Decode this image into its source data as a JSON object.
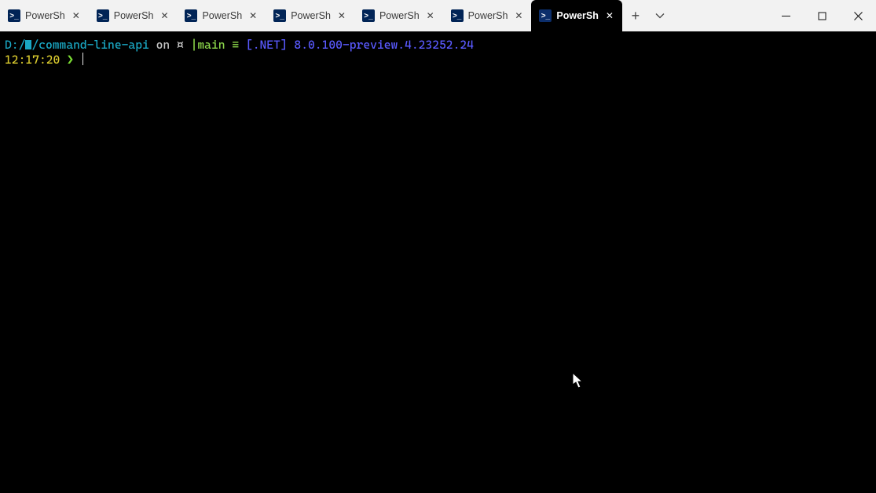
{
  "tabs": [
    {
      "label": "PowerSh",
      "active": false
    },
    {
      "label": "PowerSh",
      "active": false
    },
    {
      "label": "PowerSh",
      "active": false
    },
    {
      "label": "PowerSh",
      "active": false
    },
    {
      "label": "PowerSh",
      "active": false
    },
    {
      "label": "PowerSh",
      "active": false
    },
    {
      "label": "PowerSh",
      "active": true
    }
  ],
  "prompt": {
    "path_prefix": "D:/",
    "path_suffix": "/command-line-api",
    "on": "on",
    "github_icon": "¤",
    "branch_icon": "|",
    "branch": "main",
    "equiv": "≡",
    "dotnet": "[.NET] 8.0.100-preview.4.23252.24",
    "time": "12:17:20",
    "prompt_symbol": "❯"
  }
}
